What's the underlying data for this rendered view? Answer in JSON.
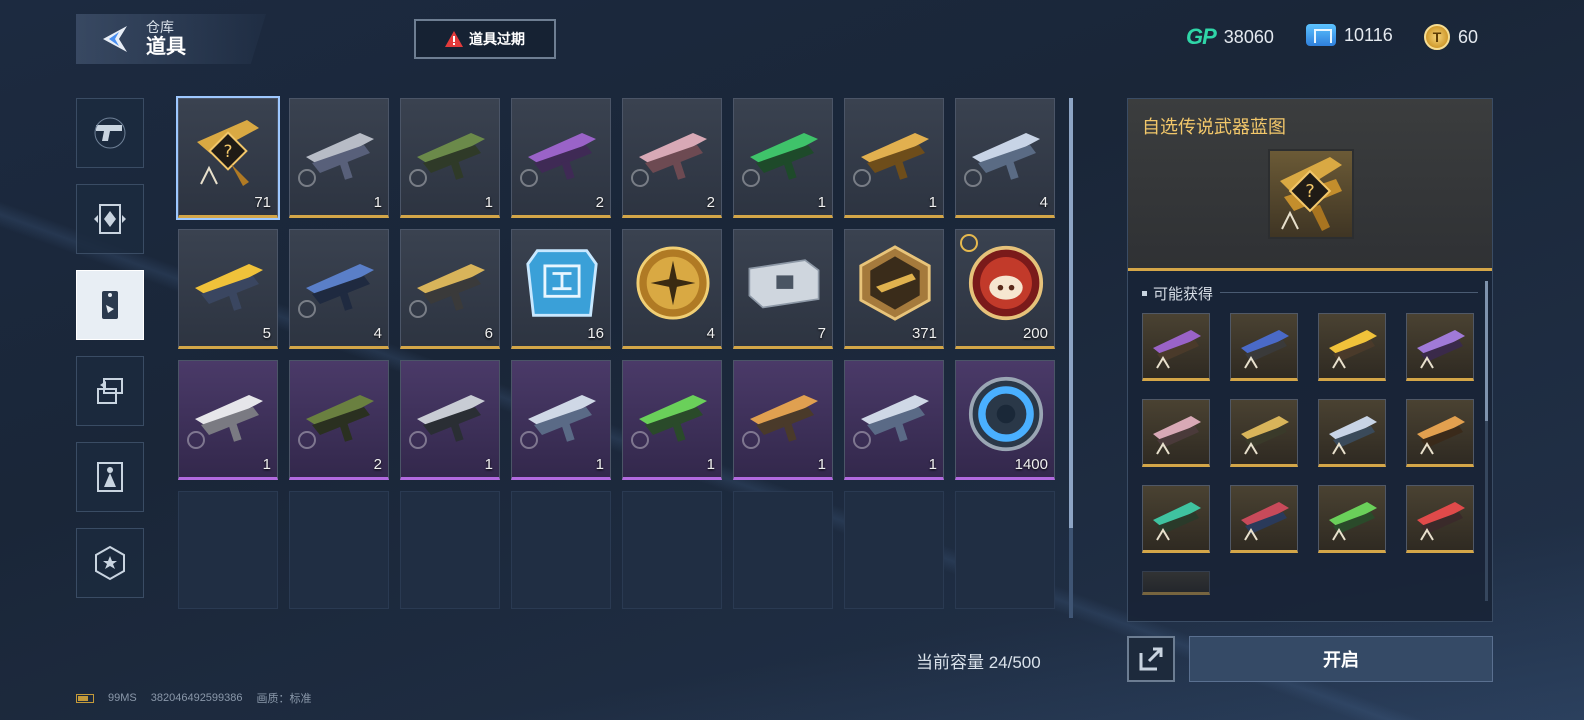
{
  "header": {
    "back_sub": "仓库",
    "back_main": "道具",
    "expire_label": "道具过期"
  },
  "currencies": [
    {
      "name": "gp",
      "icon": "gp-logo",
      "label": "GP",
      "value": "38060"
    },
    {
      "name": "ticket",
      "icon": "ticket-icon",
      "value": "10116"
    },
    {
      "name": "coin",
      "icon": "coin-icon",
      "value": "60"
    }
  ],
  "nav": [
    {
      "id": "pistol",
      "icon": "pistol-icon",
      "active": false
    },
    {
      "id": "frame",
      "icon": "frame-icon",
      "active": false
    },
    {
      "id": "tag",
      "icon": "tag-icon",
      "active": true
    },
    {
      "id": "swap",
      "icon": "swap-icon",
      "active": false
    },
    {
      "id": "character",
      "icon": "character-icon",
      "active": false
    },
    {
      "id": "badge",
      "icon": "badge-icon",
      "active": false
    }
  ],
  "items": [
    {
      "type": "gold",
      "art": "legendary-blueprint",
      "count": "71",
      "clock": false,
      "selected": true
    },
    {
      "type": "gold",
      "art": "rifle-silver",
      "count": "1",
      "clock": true
    },
    {
      "type": "gold",
      "art": "rifle-green",
      "count": "1",
      "clock": true
    },
    {
      "type": "gold",
      "art": "rifle-purple",
      "count": "2",
      "clock": true
    },
    {
      "type": "gold",
      "art": "rifle-pink",
      "count": "2",
      "clock": true
    },
    {
      "type": "gold",
      "art": "rifle-emerald",
      "count": "1",
      "clock": true
    },
    {
      "type": "gold",
      "art": "rifle-gold",
      "count": "1",
      "clock": true
    },
    {
      "type": "gold",
      "art": "knives",
      "count": "4",
      "clock": true
    },
    {
      "type": "gold",
      "art": "rifle-yellow",
      "count": "5",
      "clock": false
    },
    {
      "type": "gold",
      "art": "sniper-blue",
      "count": "4",
      "clock": true
    },
    {
      "type": "gold",
      "art": "pistol-gold",
      "count": "6",
      "clock": true
    },
    {
      "type": "gold",
      "art": "chip-card",
      "count": "16",
      "clock": false
    },
    {
      "type": "gold",
      "art": "gold-medal",
      "count": "4",
      "clock": false
    },
    {
      "type": "gold",
      "art": "weapon-case",
      "count": "7",
      "clock": false
    },
    {
      "type": "gold",
      "art": "hex-blueprint",
      "count": "371",
      "clock": false
    },
    {
      "type": "gold",
      "art": "pig-token",
      "count": "200",
      "clock": false,
      "gold_clock": true
    },
    {
      "type": "purple",
      "art": "smg-white",
      "count": "1",
      "clock": true
    },
    {
      "type": "purple",
      "art": "launcher-green",
      "count": "2",
      "clock": true
    },
    {
      "type": "purple",
      "art": "pistol-black",
      "count": "1",
      "clock": true
    },
    {
      "type": "purple",
      "art": "bow-silver",
      "count": "1",
      "clock": true
    },
    {
      "type": "purple",
      "art": "smg-green",
      "count": "1",
      "clock": true
    },
    {
      "type": "purple",
      "art": "smg-orange",
      "count": "1",
      "clock": true
    },
    {
      "type": "purple",
      "art": "bow-silver",
      "count": "1",
      "clock": true
    },
    {
      "type": "purple",
      "art": "blue-token",
      "count": "1400",
      "clock": false
    }
  ],
  "empty_slots": 8,
  "capacity_label": "当前容量 24/500",
  "detail": {
    "title": "自选传说武器蓝图",
    "section_label": "可能获得",
    "rewards": [
      {
        "art": "reward-purple"
      },
      {
        "art": "reward-blue"
      },
      {
        "art": "reward-yellow"
      },
      {
        "art": "reward-violet"
      },
      {
        "art": "reward-pink"
      },
      {
        "art": "reward-gold"
      },
      {
        "art": "reward-silver"
      },
      {
        "art": "reward-orange"
      },
      {
        "art": "reward-teal"
      },
      {
        "art": "reward-red-blue"
      },
      {
        "art": "reward-green"
      },
      {
        "art": "reward-red"
      }
    ],
    "open_label": "开启"
  },
  "status": {
    "ping": "99MS",
    "uid": "382046492599386",
    "quality": "画质：标准"
  },
  "colors": {
    "gold_rarity": "#d4a648",
    "purple_rarity": "#b26adf",
    "gp_green": "#2fd6a8",
    "title_gold": "#f2c76a"
  }
}
